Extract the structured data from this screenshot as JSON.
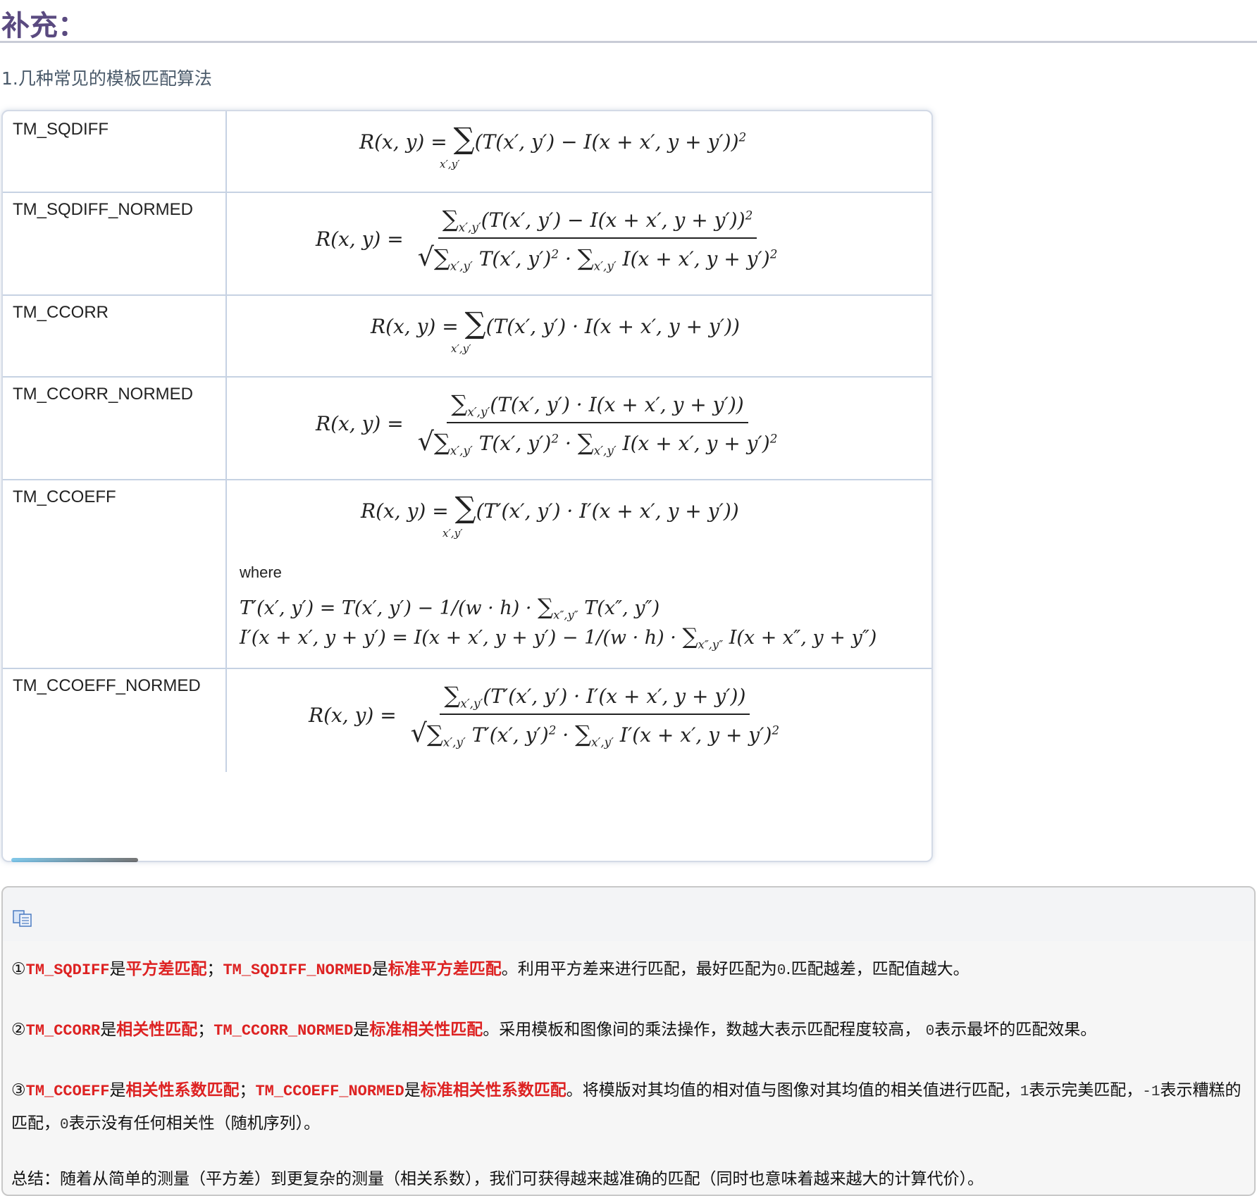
{
  "heading": "补充：",
  "subtitle": "1.几种常见的模板匹配算法",
  "methods": [
    {
      "name": "TM_SQDIFF"
    },
    {
      "name": "TM_SQDIFF_NORMED"
    },
    {
      "name": "TM_CCORR"
    },
    {
      "name": "TM_CCORR_NORMED"
    },
    {
      "name": "TM_CCOEFF",
      "where": "where"
    },
    {
      "name": "TM_CCOEFF_NORMED"
    }
  ],
  "note": {
    "copy_icon": "copy-icon",
    "p1": {
      "mark": "①",
      "code_a": "TM_SQDIFF",
      "is_a": "是",
      "red_a": "平方差匹配",
      "sep": "；",
      "code_b": "TM_SQDIFF_NORMED",
      "is_b": "是",
      "red_b": "标准平方差匹配",
      "rest": "。利用平方差来进行匹配，最好匹配为",
      "zero": "0",
      "rest2": ".匹配越差，匹配值越大。"
    },
    "p2": {
      "mark": "②",
      "code_a": "TM_CCORR",
      "is_a": "是",
      "red_a": "相关性匹配",
      "sep": "；",
      "code_b": "TM_CCORR_NORMED",
      "is_b": "是",
      "red_b": "标准相关性匹配",
      "rest": "。采用模板和图像间的乘法操作，数越大表示匹配程度较高，  ",
      "zero": "0",
      "rest2": "表示最坏的匹配效果。"
    },
    "p3": {
      "mark": "③",
      "code_a": "TM_CCOEFF",
      "is_a": "是",
      "red_a": "相关性系数匹配",
      "sep": "；",
      "code_b": "TM_CCOEFF_NORMED",
      "is_b": "是",
      "red_b": "标准相关性系数匹配",
      "rest": "。将模版对其均值的相对值与图像对其均值的相关值进行匹配，",
      "one": "1",
      "rest2": "表示完美匹配，",
      "minus_one": "-1",
      "rest3": "表示糟糕的匹配，",
      "zero": "0",
      "rest4": "表示没有任何相关性（随机序列）。"
    },
    "summary": "总结：随着从简单的测量（平方差）到更复杂的测量（相关系数），我们可获得越来越准确的匹配（同时也意味着越来越大的计算代价）。"
  }
}
